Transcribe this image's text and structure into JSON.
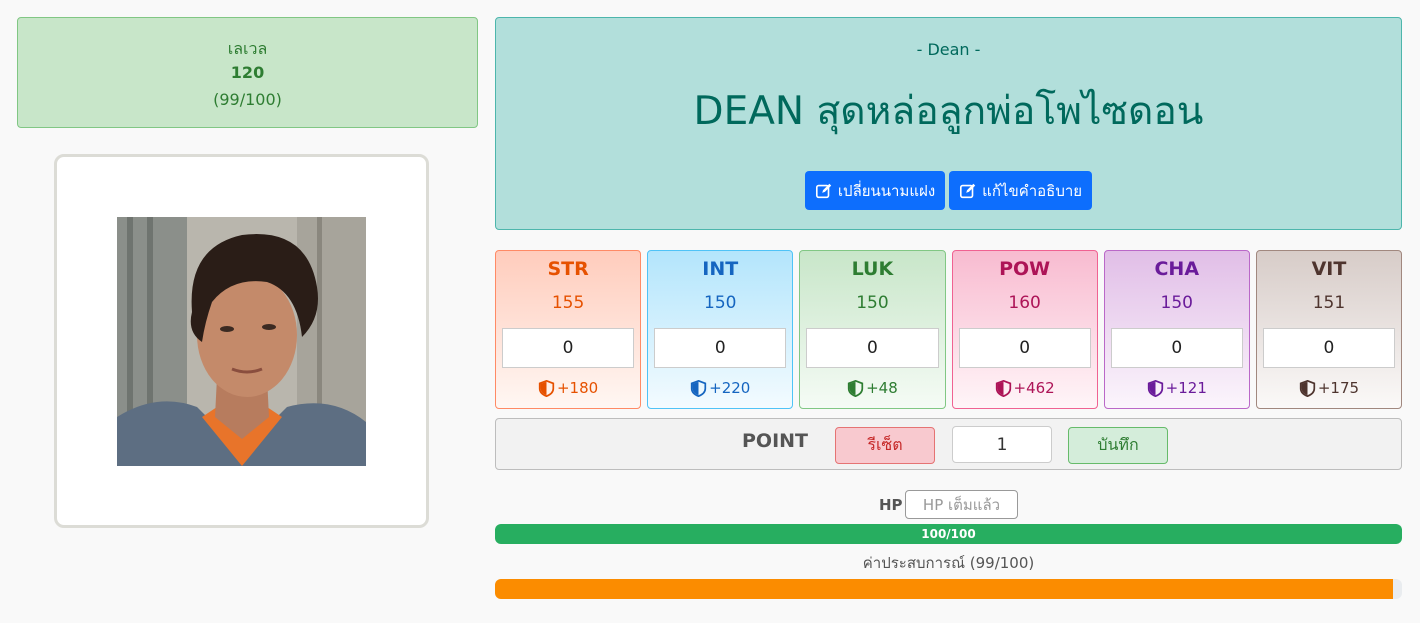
{
  "level": {
    "label": "เลเวล",
    "value": "120",
    "exp_text": "(99/100)"
  },
  "profile": {
    "subtitle": "- Dean -",
    "title": "DEAN สุดหล่อลูกพ่อโพไซดอน",
    "rename_label": "เปลี่ยนนามแฝง",
    "edit_desc_label": "แก้ไขคำอธิบาย"
  },
  "stats": [
    {
      "name": "STR",
      "value": "155",
      "input": "0",
      "bonus": "+180",
      "color": "#e65100"
    },
    {
      "name": "INT",
      "value": "150",
      "input": "0",
      "bonus": "+220",
      "color": "#1565c0"
    },
    {
      "name": "LUK",
      "value": "150",
      "input": "0",
      "bonus": "+48",
      "color": "#2e7d32"
    },
    {
      "name": "POW",
      "value": "160",
      "input": "0",
      "bonus": "+462",
      "color": "#ad1457"
    },
    {
      "name": "CHA",
      "value": "150",
      "input": "0",
      "bonus": "+121",
      "color": "#6a1b9a"
    },
    {
      "name": "VIT",
      "value": "151",
      "input": "0",
      "bonus": "+175",
      "color": "#4e342e"
    }
  ],
  "points": {
    "label": "POINT",
    "reset_label": "รีเซ็ต",
    "value": "1",
    "save_label": "บันทึก"
  },
  "hp": {
    "label": "HP",
    "button_label": "HP เต็มแล้ว",
    "bar_text": "100/100",
    "fraction": 1.0,
    "color": "#27ae60"
  },
  "exp": {
    "label": "ค่าประสบการณ์ (99/100)",
    "fraction": 0.99,
    "color": "#fb8c00"
  }
}
